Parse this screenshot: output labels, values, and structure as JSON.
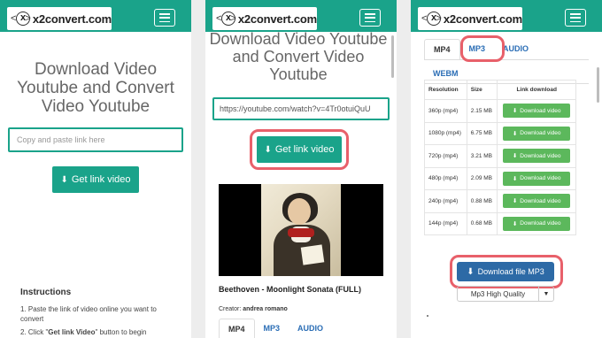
{
  "header": {
    "logo_text": "x2convert.com",
    "logo_x": "x",
    "logo_chev_left": "<",
    "logo_chev_right": ">"
  },
  "screen1": {
    "title": "Download Video Youtube and Convert Video Youtube",
    "input_placeholder": "Copy and paste link here",
    "get_link_label": "Get link video",
    "instructions_title": "Instructions",
    "step1": "1. Paste the link of video online you want to convert",
    "step2_prefix": "2. Click \"",
    "step2_bold": "Get link Video",
    "step2_suffix": "\" button to begin"
  },
  "screen2": {
    "title": "Download Video Youtube and Convert Video Youtube",
    "input_value": "https://youtube.com/watch?v=4Tr0otuiQuU",
    "get_link_label": "Get link video",
    "video_title": "Beethoven - Moonlight Sonata (FULL)",
    "creator_label": "Creator:",
    "creator_name": "andrea romano",
    "tabs": [
      "MP4",
      "MP3",
      "AUDIO"
    ]
  },
  "screen3": {
    "tabs_row1": [
      "MP4",
      "MP3",
      "AUDIO"
    ],
    "tabs_row2": [
      "WEBM"
    ],
    "table_headers": [
      "Resolution",
      "Size",
      "Link download"
    ],
    "rows": [
      {
        "resolution": "360p (mp4)",
        "size": "2.15 MB",
        "link": "Download video"
      },
      {
        "resolution": "1080p (mp4)",
        "size": "6.75 MB",
        "link": "Download video"
      },
      {
        "resolution": "720p (mp4)",
        "size": "3.21 MB",
        "link": "Download video"
      },
      {
        "resolution": "480p (mp4)",
        "size": "2.09 MB",
        "link": "Download video"
      },
      {
        "resolution": "240p (mp4)",
        "size": "0.88 MB",
        "link": "Download video"
      },
      {
        "resolution": "144p (mp4)",
        "size": "0.68 MB",
        "link": "Download video"
      }
    ],
    "mp3_button_label": "Download file MP3",
    "quality_label": "Mp3 High Quality"
  },
  "colors": {
    "brand": "#1aa38a",
    "highlight_ring": "#e8606a",
    "download_green": "#5cb85c",
    "mp3_blue": "#2d6aa6",
    "link_blue": "#2a6db5"
  },
  "icons": {
    "download": "download-icon",
    "menu": "hamburger-menu-icon"
  }
}
